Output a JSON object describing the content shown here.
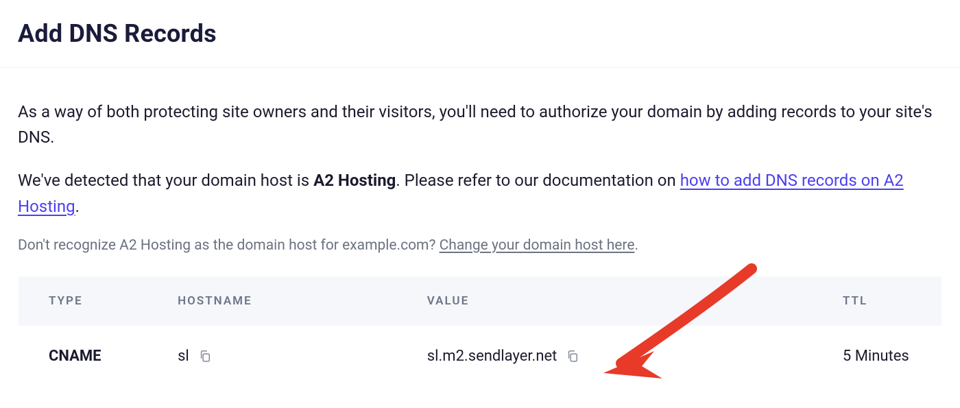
{
  "title": "Add DNS Records",
  "intro": "As a way of both protecting site owners and their visitors, you'll need to authorize your domain by adding records to your site's DNS.",
  "detected": {
    "prefix": "We've detected that your domain host is ",
    "host": "A2 Hosting",
    "middle": ". Please refer to our documentation on ",
    "link": "how to add DNS records on A2 Hosting",
    "suffix": "."
  },
  "not_recognize": {
    "text": "Don't recognize A2 Hosting as the domain host for example.com? ",
    "link": "Change your domain host here",
    "suffix": "."
  },
  "table": {
    "headers": {
      "type": "TYPE",
      "hostname": "HOSTNAME",
      "value": "VALUE",
      "ttl": "TTL"
    },
    "row": {
      "type": "CNAME",
      "hostname": "sl",
      "value": "sl.m2.sendlayer.net",
      "ttl": "5 Minutes"
    }
  }
}
